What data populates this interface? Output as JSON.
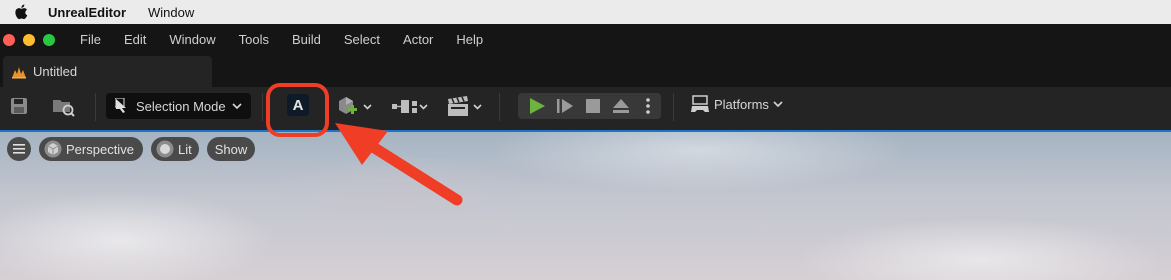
{
  "macos_menu": {
    "app_name": "UnrealEditor",
    "items": [
      "Window"
    ]
  },
  "window_menu": {
    "items": [
      "File",
      "Edit",
      "Window",
      "Tools",
      "Build",
      "Select",
      "Actor",
      "Help"
    ]
  },
  "tab": {
    "label": "Untitled",
    "icon": "unreal-level-icon"
  },
  "toolbar": {
    "save_icon": "save-icon",
    "browse_icon": "content-browser-icon",
    "mode_label": "Selection Mode",
    "highlighted_button_glyph": "A",
    "platforms_label": "Platforms"
  },
  "viewport": {
    "menu_icon": "hamburger-icon",
    "perspective_label": "Perspective",
    "lit_label": "Lit",
    "show_label": "Show"
  },
  "colors": {
    "accent_highlight": "#f03d26",
    "play_green": "#6db33f",
    "traffic_red": "#ff5f57",
    "traffic_yellow": "#febc2e",
    "traffic_green": "#28c840",
    "viewport_border": "#1e74c8"
  }
}
